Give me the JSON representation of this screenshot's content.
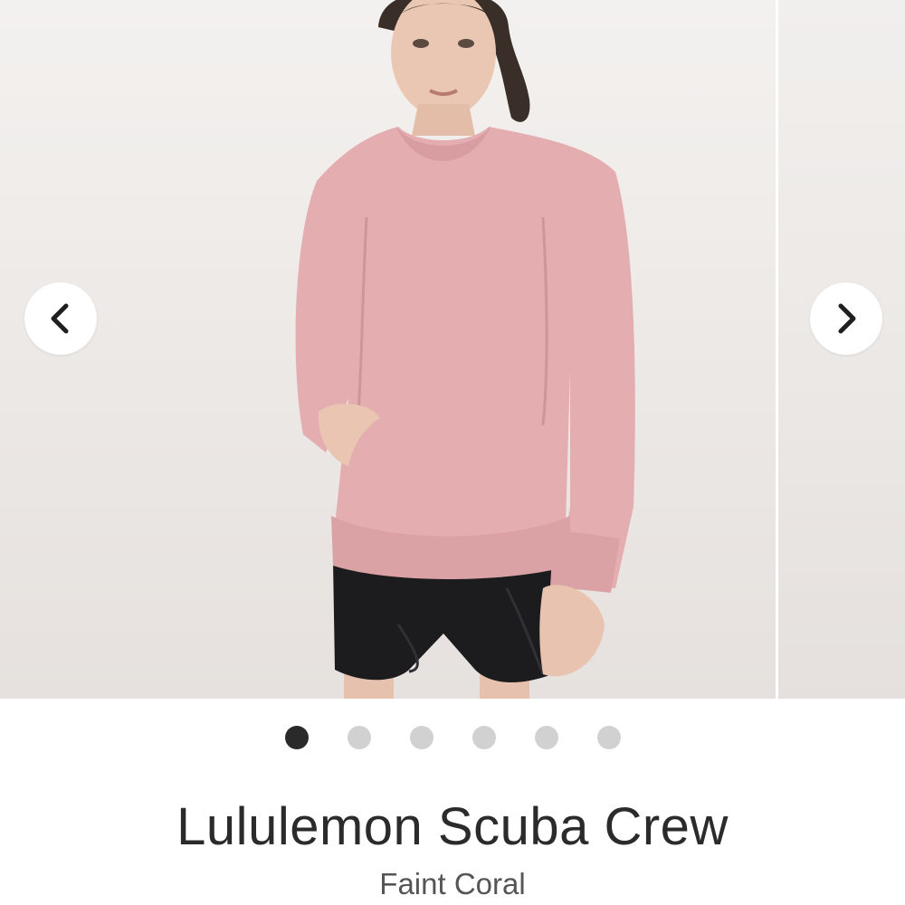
{
  "product": {
    "title": "Lululemon Scuba Crew",
    "color_name": "Faint Coral"
  },
  "carousel": {
    "slide_count": 6,
    "active_index": 0,
    "prev_icon": "chevron-left-icon",
    "next_icon": "chevron-right-icon"
  },
  "colors": {
    "sweater": "#e4aeb1",
    "shorts": "#1c1c1f",
    "dot_active": "#2a2a2a",
    "dot_inactive": "#d1d1d1"
  }
}
